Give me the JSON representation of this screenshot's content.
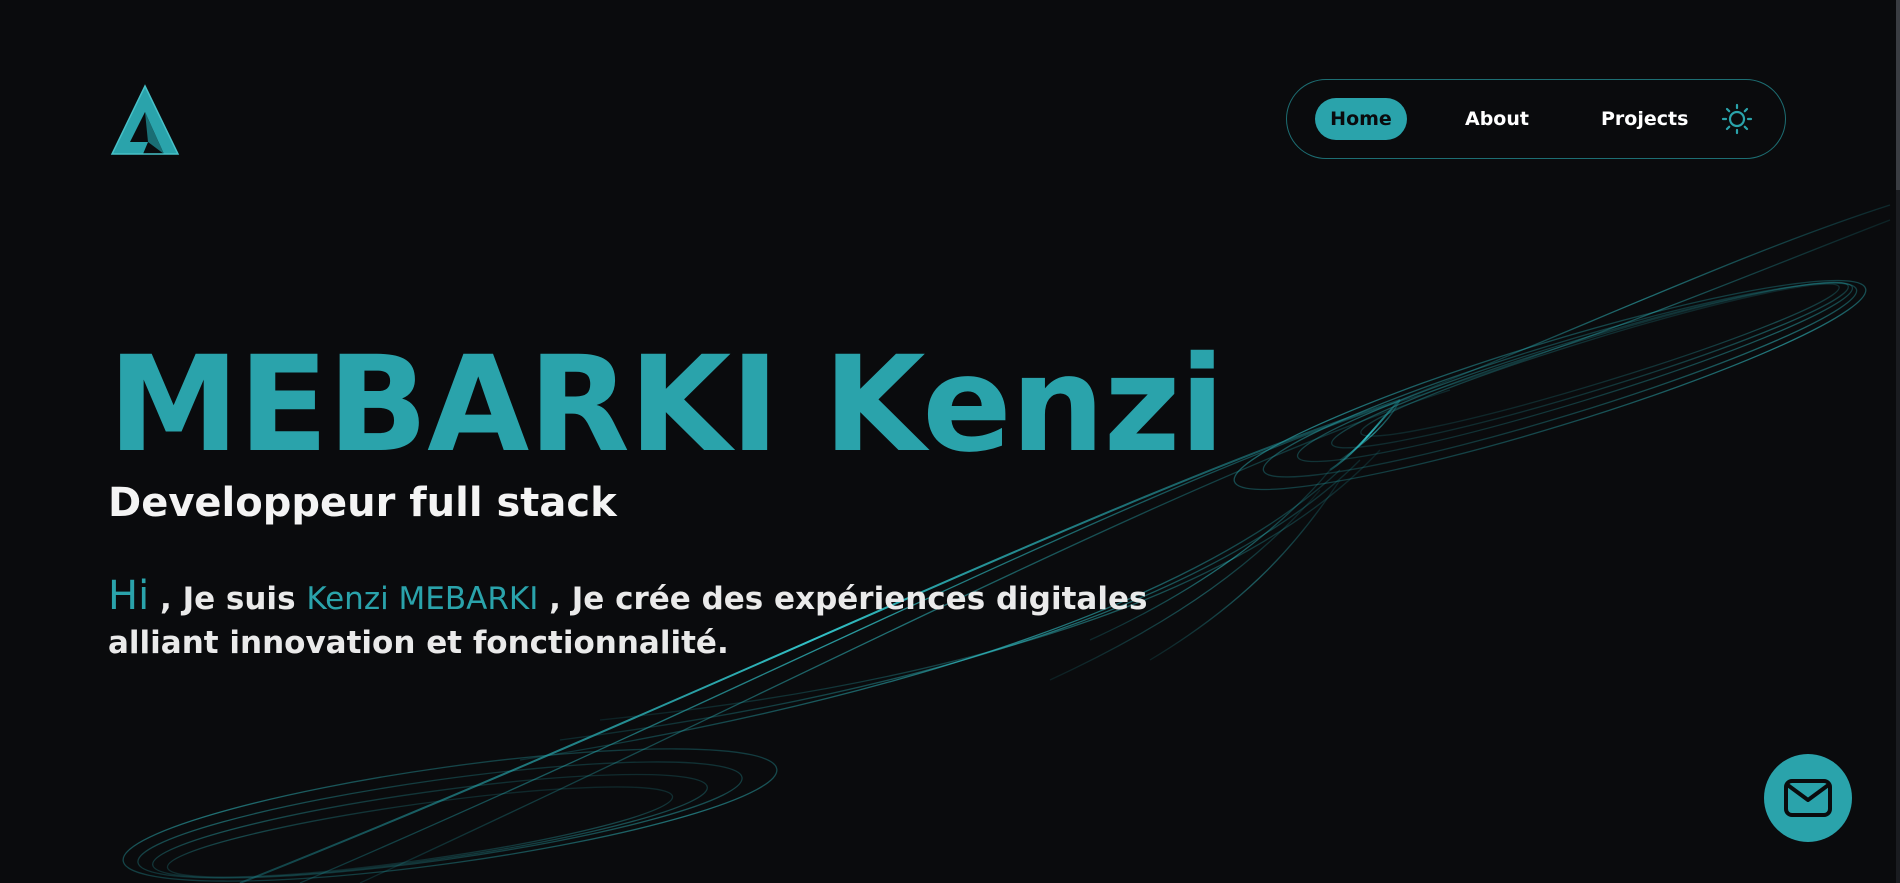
{
  "brand": {
    "logo_icon": "letter-a-logo-icon",
    "accent_color": "#2aa3ab",
    "background_color": "#0a0b0d"
  },
  "nav": {
    "items": [
      {
        "label": "Home",
        "active": true
      },
      {
        "label": "About",
        "active": false
      },
      {
        "label": "Projects",
        "active": false
      }
    ],
    "theme_toggle_icon": "sun-icon"
  },
  "hero": {
    "title": "MEBARKI Kenzi",
    "subtitle": "Developpeur full stack",
    "intro": {
      "greeting": "Hi",
      "part1": " , Je suis ",
      "name": "Kenzi MEBARKI",
      "part2": " , Je crée des expériences digitales alliant innovation et fonctionnalité."
    }
  },
  "contact": {
    "icon": "envelope-icon"
  }
}
